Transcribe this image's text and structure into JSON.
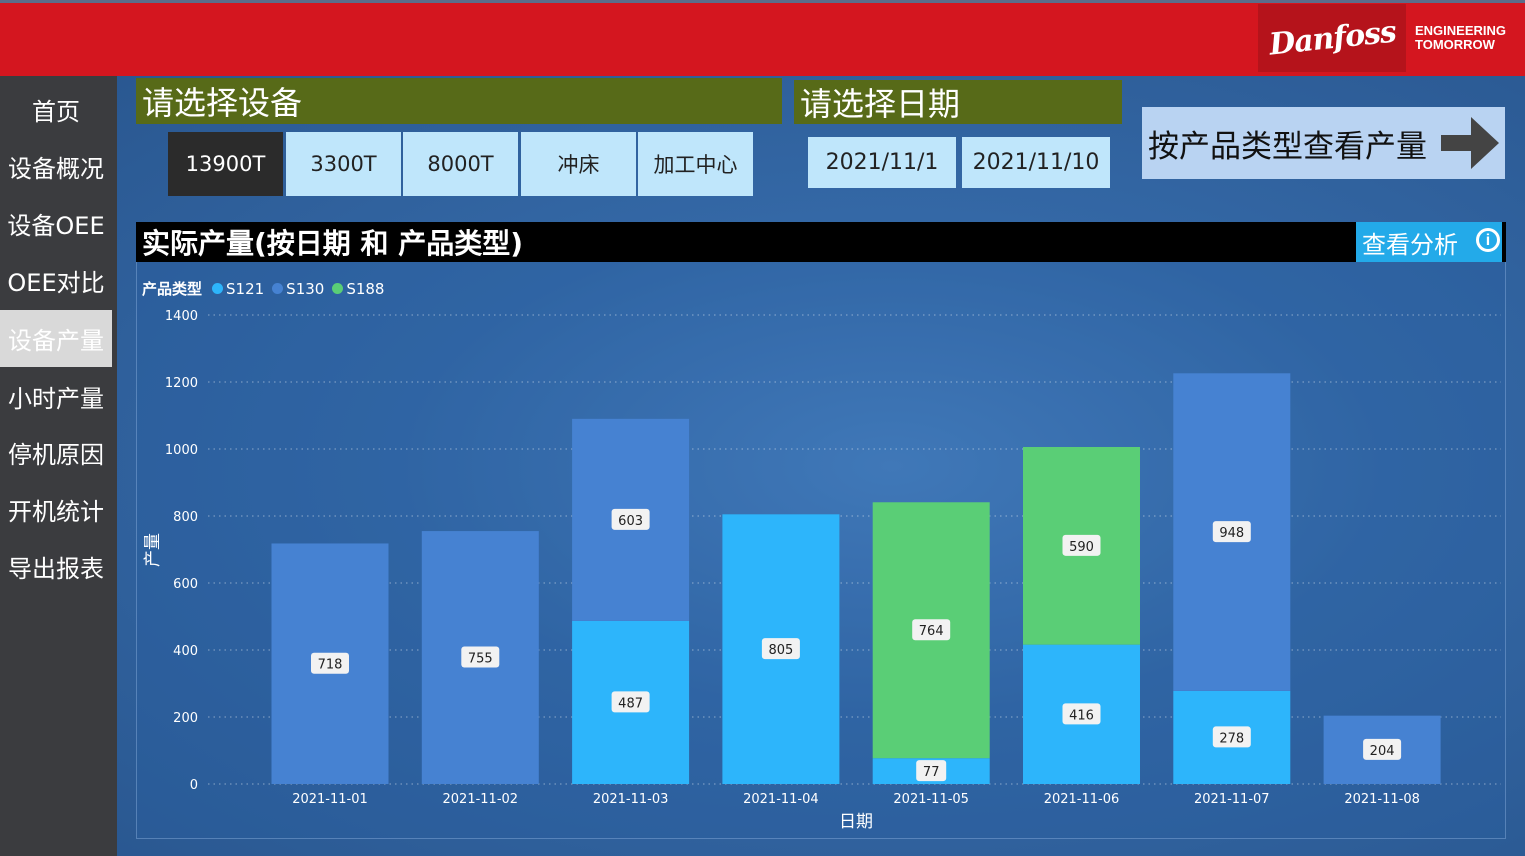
{
  "header": {
    "logo_text": "Danfoss",
    "tagline_line1": "ENGINEERING",
    "tagline_line2": "TOMORROW",
    "colors": {
      "topbar": "#d4161f",
      "sidebar": "#3b3c3f"
    }
  },
  "sidebar": {
    "items": [
      {
        "label": "首页",
        "active": false
      },
      {
        "label": "设备概况",
        "active": false
      },
      {
        "label": "设备OEE",
        "active": false
      },
      {
        "label": "OEE对比",
        "active": false
      },
      {
        "label": "设备产量",
        "active": true
      },
      {
        "label": "小时产量",
        "active": false
      },
      {
        "label": "停机原因",
        "active": false
      },
      {
        "label": "开机统计",
        "active": false
      },
      {
        "label": "导出报表",
        "active": false
      }
    ]
  },
  "device_select": {
    "title": "请选择设备",
    "buttons": [
      {
        "label": "13900T",
        "selected": true
      },
      {
        "label": "3300T",
        "selected": false
      },
      {
        "label": "8000T",
        "selected": false
      },
      {
        "label": "冲床",
        "selected": false
      },
      {
        "label": "加工中心",
        "selected": false
      }
    ]
  },
  "date_select": {
    "title": "请选择日期",
    "start": "2021/11/1",
    "end": "2021/11/10"
  },
  "product_type_button": {
    "label": "按产品类型查看产量",
    "icon": "arrow-right-icon"
  },
  "chart_panel": {
    "title": "实际产量(按日期 和 产品类型)",
    "analysis_button": "查看分析",
    "analysis_icon": "info-icon"
  },
  "chart_data": {
    "type": "bar",
    "stacked": true,
    "legend_title": "产品类型",
    "legend_position": "top-left",
    "xlabel": "日期",
    "ylabel": "产量",
    "ylim": [
      0,
      1400
    ],
    "yticks": [
      0,
      200,
      400,
      600,
      800,
      1000,
      1200,
      1400
    ],
    "grid": true,
    "categories": [
      "2021-11-01",
      "2021-11-02",
      "2021-11-03",
      "2021-11-04",
      "2021-11-05",
      "2021-11-06",
      "2021-11-07",
      "2021-11-08"
    ],
    "series": [
      {
        "name": "S121",
        "color": "#2db5fb",
        "values": [
          0,
          0,
          487,
          805,
          77,
          416,
          278,
          0
        ]
      },
      {
        "name": "S130",
        "color": "#4682d2",
        "values": [
          718,
          755,
          603,
          0,
          0,
          0,
          948,
          204
        ]
      },
      {
        "name": "S188",
        "color": "#5ace76",
        "values": [
          0,
          0,
          0,
          0,
          764,
          590,
          0,
          0
        ]
      }
    ]
  }
}
